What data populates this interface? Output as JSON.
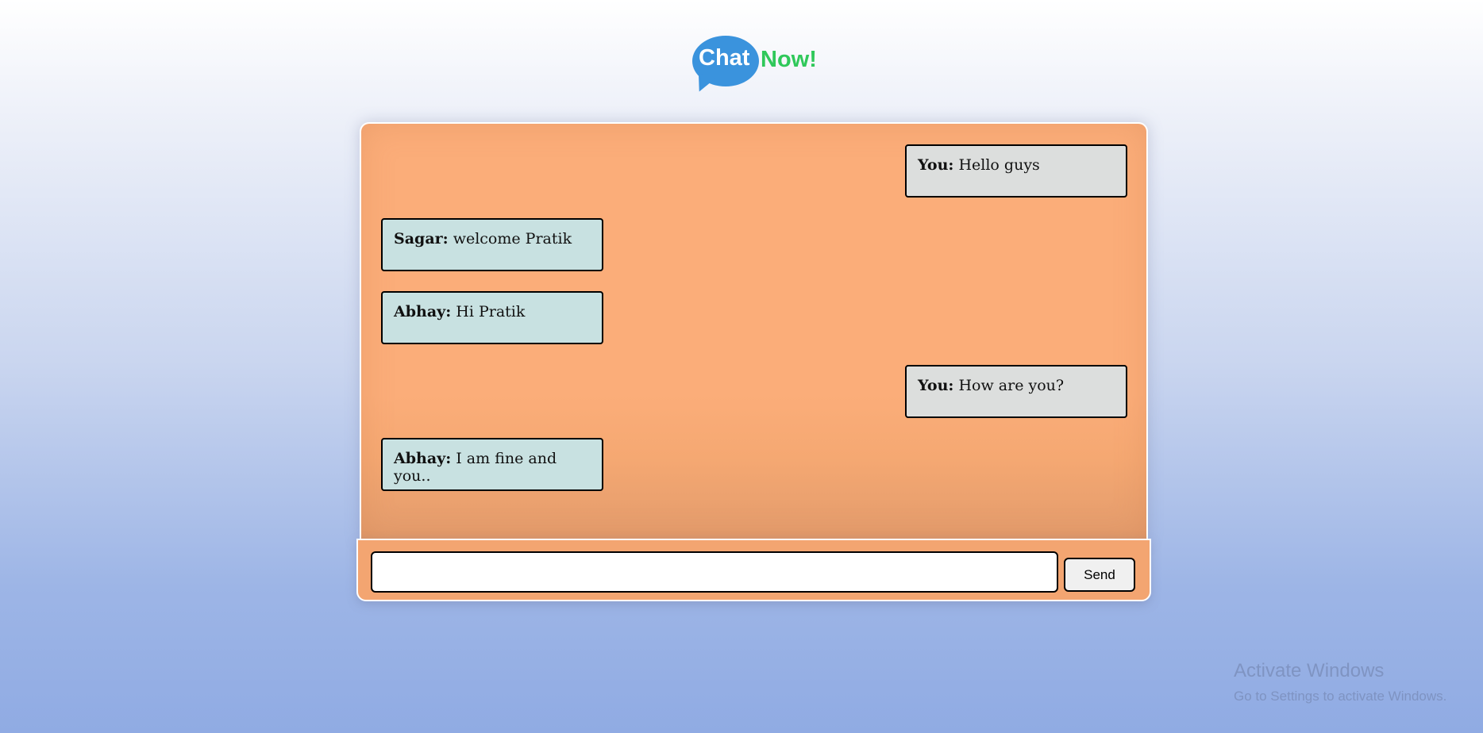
{
  "logo": {
    "chat_text": "Chat",
    "now_text": "Now!",
    "bubble_color": "#3a93dd",
    "now_color": "#2fc85a"
  },
  "messages": [
    {
      "sender": "You:",
      "text": "Hello guys",
      "side": "right"
    },
    {
      "sender": "Sagar:",
      "text": "welcome Pratik",
      "side": "left"
    },
    {
      "sender": "Abhay:",
      "text": "Hi Pratik",
      "side": "left"
    },
    {
      "sender": "You:",
      "text": "How are you?",
      "side": "right"
    },
    {
      "sender": "Abhay:",
      "text": "I am fine and you..",
      "side": "left"
    }
  ],
  "composer": {
    "input_value": "",
    "send_label": "Send"
  },
  "watermark": {
    "title": "Activate Windows",
    "subtitle": "Go to Settings to activate Windows."
  },
  "colors": {
    "panel": "#fbad79",
    "self_bubble": "#dcdedd",
    "other_bubble": "#c8e1e1"
  }
}
